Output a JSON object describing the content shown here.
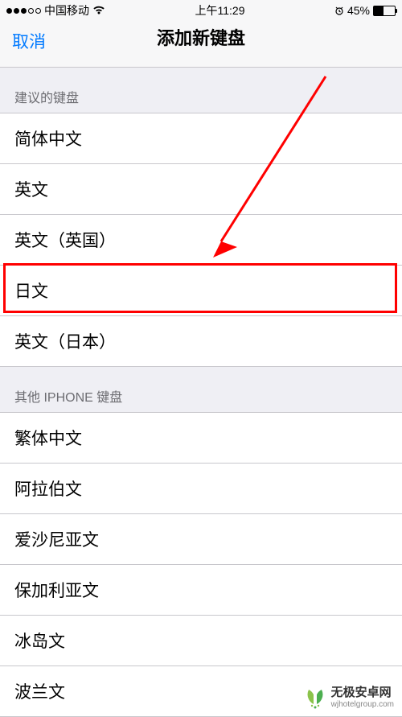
{
  "status": {
    "carrier": "中国移动",
    "time": "上午11:29",
    "battery_pct": "45%"
  },
  "nav": {
    "cancel": "取消",
    "title": "添加新键盘"
  },
  "section1": {
    "header": "建议的键盘",
    "items": [
      "简体中文",
      "英文",
      "英文（英国）",
      "日文",
      "英文（日本）"
    ]
  },
  "section2": {
    "header": "其他 IPHONE 键盘",
    "items": [
      "繁体中文",
      "阿拉伯文",
      "爱沙尼亚文",
      "保加利亚文",
      "冰岛文",
      "波兰文"
    ]
  },
  "watermark": {
    "title": "无极安卓网",
    "url": "wjhotelgroup.com"
  }
}
